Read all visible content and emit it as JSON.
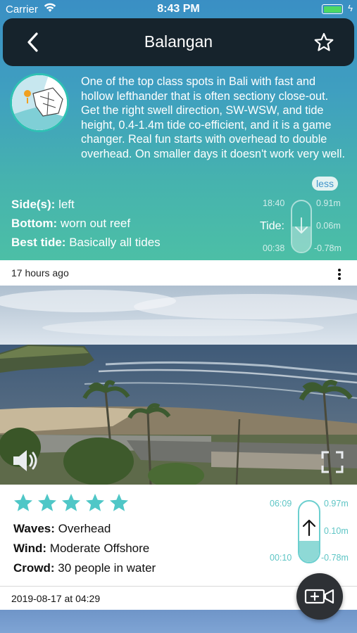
{
  "status_bar": {
    "carrier": "Carrier",
    "time": "8:43 PM"
  },
  "navbar": {
    "title": "Balangan",
    "back_icon": "chevron-left-icon",
    "favorite_icon": "star-outline-icon"
  },
  "spot": {
    "description": "One of the top class spots in Bali with fast and hollow lefthander that is often sectiony close-out. Get the right swell direction, SW-WSW,  and tide height, 0.4-1.4m tide co-efficient, and it is a game changer. Real fun starts with overhead to double overhead. On smaller days it doesn't work very well.",
    "less_label": "less",
    "sides_label": "Side(s):",
    "sides_value": "left",
    "bottom_label": "Bottom:",
    "bottom_value": "worn out reef",
    "best_tide_label": "Best tide:",
    "best_tide_value": "Basically all tides"
  },
  "tide_hero": {
    "label": "Tide:",
    "high_time": "18:40",
    "high_height": "0.91m",
    "current_height": "0.06m",
    "low_time": "00:38",
    "low_height": "-0.78m",
    "direction": "falling",
    "fill_fraction": 0.5
  },
  "post": {
    "time_ago": "17 hours ago",
    "rating": 5,
    "waves_label": "Waves:",
    "waves_value": "Overhead",
    "wind_label": "Wind:",
    "wind_value": "Moderate Offshore",
    "crowd_label": "Crowd:",
    "crowd_value": "30 people in water",
    "date": "2019-08-17 at 04:29"
  },
  "tide_report": {
    "high_time": "06:09",
    "high_height": "0.97m",
    "current_height": "0.10m",
    "low_time": "00:10",
    "low_height": "-0.78m",
    "direction": "rising",
    "fill_fraction": 0.35
  },
  "colors": {
    "accent": "#4fc7c7",
    "navbar": "#16232c",
    "star": "#4fc7c7"
  }
}
